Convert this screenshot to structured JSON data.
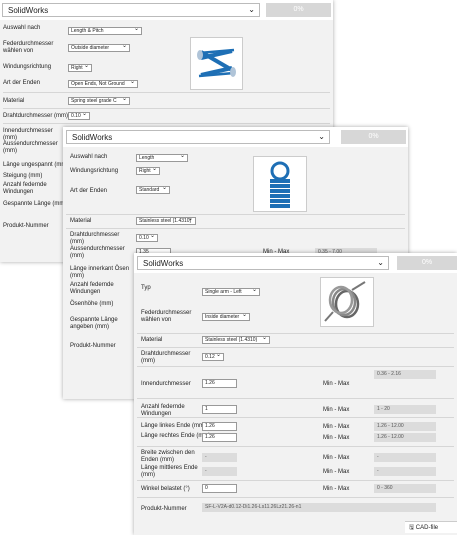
{
  "p1": {
    "app": "SolidWorks",
    "progress": "0%",
    "fields": {
      "auswahl": {
        "label": "Auswahl nach",
        "value": "Length & Pitch"
      },
      "feder": {
        "label": "Federdurchmesser wählen von",
        "value": "Outside diameter"
      },
      "winding": {
        "label": "Windungsrichtung",
        "value": "Right"
      },
      "enden": {
        "label": "Art der Enden",
        "value": "Open Ends, Not Ground"
      },
      "material": {
        "label": "Material",
        "value": "Spring steel grade C"
      },
      "draht": {
        "label": "Drahtdurchmesser (mm)",
        "value": "0.10"
      }
    },
    "labels": {
      "innen": "Innendurchmesser (mm)",
      "aussen": "Aussendurchmesser (mm)",
      "laenge": "Länge ungespannt (mm)",
      "steigung": "Steigung (mm)",
      "anzahl": "Anzahl federnde Windungen",
      "gespannt": "Gespannte Länge (mm)",
      "produkt": "Produkt-Nummer"
    }
  },
  "p2": {
    "app": "SolidWorks",
    "progress": "0%",
    "fields": {
      "auswahl": {
        "label": "Auswahl nach",
        "value": "Length"
      },
      "winding": {
        "label": "Windungsrichtung",
        "value": "Right"
      },
      "enden": {
        "label": "Art der Enden",
        "value": "Standard"
      },
      "material": {
        "label": "Material",
        "value": "Stainless steel (1.4310)"
      },
      "draht": {
        "label": "Drahtdurchmesser (mm)",
        "value": "0.10"
      }
    },
    "aussen": {
      "label": "Aussendurchmesser (mm)",
      "value": "1.35",
      "minmax": "Min - Max",
      "range": "0.35 - 7.00"
    },
    "labels": {
      "laenge": "Länge innerkant Ösen (mm)",
      "anzahl": "Anzahl federnde Windungen",
      "oesen": "Ösenhöhe (mm)",
      "gespannt": "Gespannte Länge angeben (mm)",
      "produkt": "Produkt-Nummer"
    }
  },
  "p3": {
    "app": "SolidWorks",
    "progress": "0%",
    "fields": {
      "typ": {
        "label": "Typ",
        "value": "Single arm - Left"
      },
      "feder": {
        "label": "Federdurchmesser wählen von",
        "value": "Inside diameter"
      },
      "material": {
        "label": "Material",
        "value": "Stainless steel (1.4310)"
      },
      "draht": {
        "label": "Drahtdurchmesser (mm)",
        "value": "0.12"
      }
    },
    "innen": {
      "label": "Innendurchmesser",
      "value": "1.26",
      "minmax": "Min - Max",
      "range": "0.36 - 2.16"
    },
    "anzahl": {
      "label": "Anzahl federnde Windungen",
      "value": "1",
      "minmax": "Min - Max",
      "range": "1 - 20"
    },
    "links": {
      "label": "Länge linkes Ende (mm)",
      "value": "1.26",
      "minmax": "Min - Max",
      "range": "1.26 - 12.00"
    },
    "rechts": {
      "label": "Länge rechtes Ende (mm)",
      "value": "1.26",
      "minmax": "Min - Max",
      "range": "1.26 - 12.00"
    },
    "breite": {
      "label": "Breite zwischen den Enden (mm)",
      "value": "-",
      "minmax": "Min - Max",
      "range": "-"
    },
    "mittel": {
      "label": "Länge mittleres Ende (mm)",
      "value": "-",
      "minmax": "Min - Max",
      "range": "-"
    },
    "winkel": {
      "label": "Winkel belastet (°)",
      "value": "0",
      "minmax": "Min - Max",
      "range": "0 - 360"
    },
    "produkt": {
      "label": "Produkt-Nummer",
      "value": "SF-L-V2A-d0.12-Di1.26-Ls11.26Lz21.26-n1"
    },
    "cad": "CAD-file"
  }
}
